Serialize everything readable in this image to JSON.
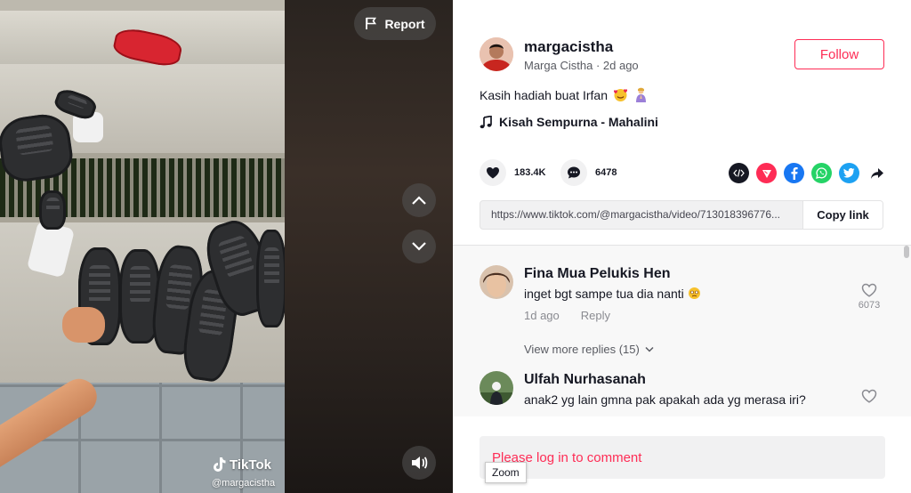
{
  "video": {
    "report_label": "Report",
    "watermark_brand": "TikTok",
    "watermark_user": "@margacistha"
  },
  "author": {
    "username": "margacistha",
    "display_name": "Marga Cistha",
    "posted": "2d ago",
    "follow_label": "Follow"
  },
  "post": {
    "caption": "Kasih hadiah buat Irfan",
    "caption_emojis": [
      "smiling-face-with-hearts",
      "woman-praying"
    ],
    "music": "Kisah Sempurna - Mahalini"
  },
  "stats": {
    "likes": "183.4K",
    "comments": "6478"
  },
  "share": {
    "icons": [
      "embed-icon",
      "send-to-friends-icon",
      "facebook-icon",
      "whatsapp-icon",
      "twitter-icon",
      "share-arrow-icon"
    ],
    "link_url": "https://www.tiktok.com/@margacistha/video/713018396776...",
    "copy_label": "Copy link"
  },
  "comments": [
    {
      "name": "Fina Mua Pelukis Hen",
      "text": "inget bgt sampe tua dia nanti",
      "emoji": "face-holding-back-tears",
      "time": "1d ago",
      "reply_label": "Reply",
      "likes": "6073",
      "view_more": "View more replies (15)"
    },
    {
      "name": "Ulfah Nurhasanah",
      "text": "anak2 yg lain gmna pak apakah ada yg merasa iri?",
      "likes": ""
    }
  ],
  "login_prompt": "Please log in to comment",
  "tooltip": "Zoom",
  "colors": {
    "accent": "#fe2c55",
    "text": "#161823"
  }
}
